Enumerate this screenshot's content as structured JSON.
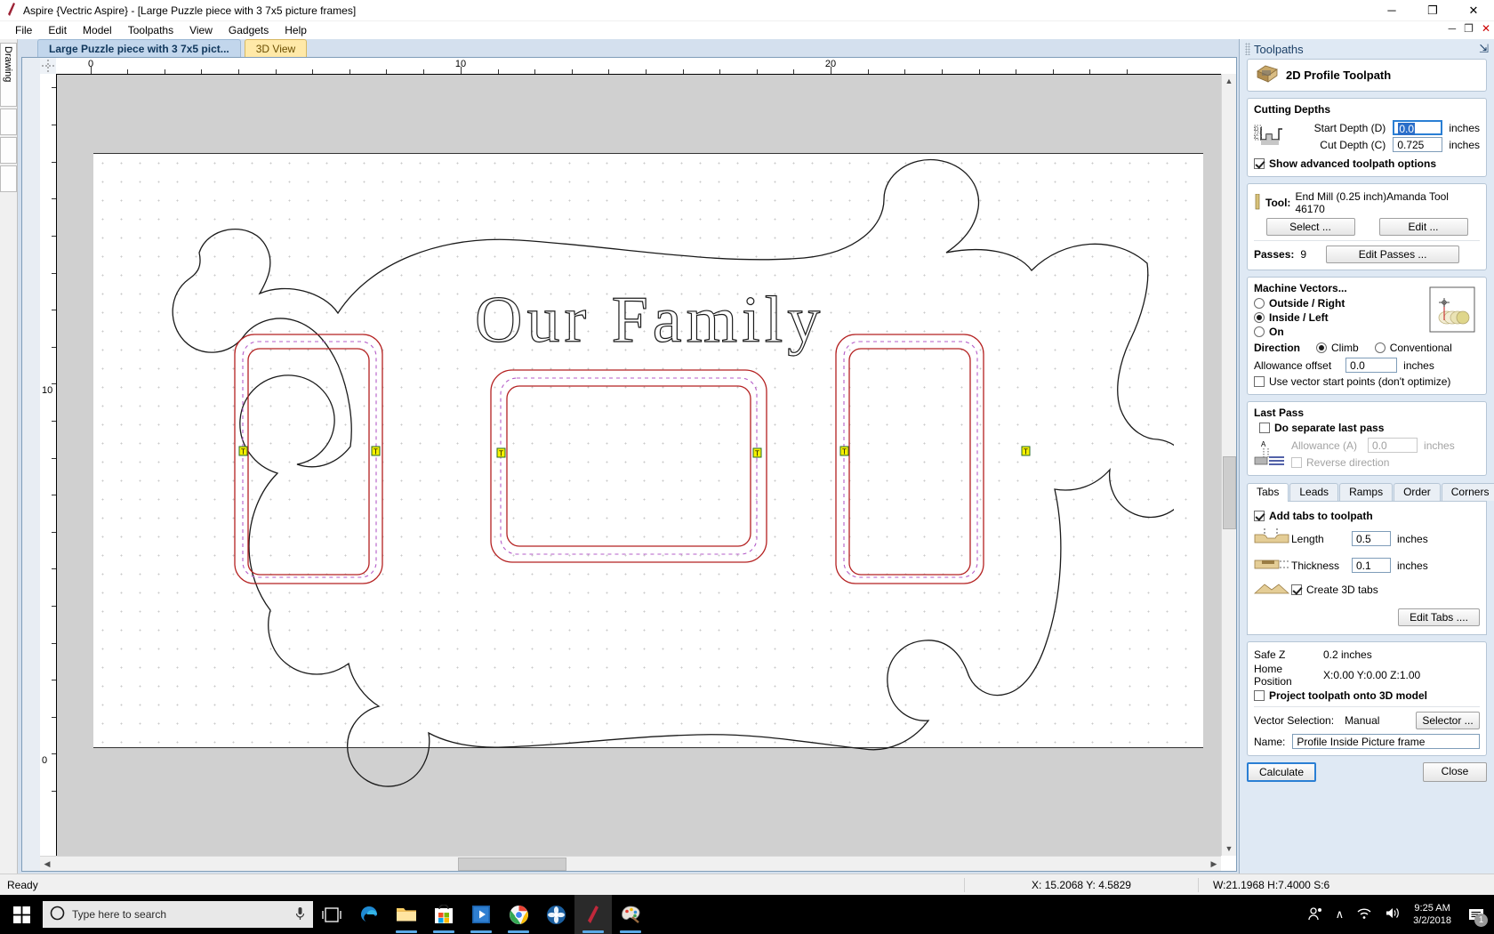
{
  "window": {
    "title": "Aspire {Vectric Aspire} - [Large Puzzle piece with 3 7x5 picture frames]",
    "minimize": "─",
    "maximize": "❐",
    "close": "✕",
    "inner_restore": "❐",
    "inner_min": "─",
    "inner_close": "✕"
  },
  "menu": [
    "File",
    "Edit",
    "Model",
    "Toolpaths",
    "View",
    "Gadgets",
    "Help"
  ],
  "left_strip": {
    "label": "Drawing"
  },
  "doc_tabs": [
    {
      "label": "Large Puzzle piece with 3 7x5 pict...",
      "active": true
    },
    {
      "label": "3D View",
      "active": false
    }
  ],
  "ruler": {
    "h_labels": [
      "0",
      "10",
      "20"
    ],
    "v_labels": [
      "10",
      "0"
    ]
  },
  "canvas": {
    "headline_text": "Our Family"
  },
  "toolpaths": {
    "panel_title": "Toolpaths",
    "pin_icon": "⇲",
    "header": "2D Profile Toolpath",
    "cutting_depths": {
      "title": "Cutting Depths",
      "start_label": "Start Depth (D)",
      "start_value": "0.0",
      "start_units": "inches",
      "cut_label": "Cut Depth (C)",
      "cut_value": "0.725",
      "cut_units": "inches",
      "advanced_label": "Show advanced toolpath options",
      "advanced_checked": true
    },
    "tool": {
      "label": "Tool:",
      "name": "End Mill (0.25 inch)Amanda Tool 46170",
      "select_btn": "Select ...",
      "edit_btn": "Edit ...",
      "passes_label": "Passes:",
      "passes_value": "9",
      "edit_passes_btn": "Edit Passes ..."
    },
    "machine_vectors": {
      "title": "Machine Vectors...",
      "options": [
        {
          "label": "Outside / Right",
          "selected": false
        },
        {
          "label": "Inside / Left",
          "selected": true
        },
        {
          "label": "On",
          "selected": false
        }
      ],
      "direction_label": "Direction",
      "directions": [
        {
          "label": "Climb",
          "selected": true
        },
        {
          "label": "Conventional",
          "selected": false
        }
      ],
      "allowance_label": "Allowance offset",
      "allowance_value": "0.0",
      "allowance_units": "inches",
      "vector_start_label": "Use vector start points (don't optimize)",
      "vector_start_checked": false
    },
    "last_pass": {
      "title": "Last Pass",
      "separate_label": "Do separate last pass",
      "separate_checked": false,
      "allowance_label": "Allowance (A)",
      "allowance_value": "0.0",
      "allowance_units": "inches",
      "reverse_label": "Reverse direction",
      "reverse_checked": false,
      "pic_letter": "A"
    },
    "tabs_widget": {
      "tabs": [
        "Tabs",
        "Leads",
        "Ramps",
        "Order",
        "Corners"
      ],
      "active": "Tabs",
      "add_tabs_label": "Add tabs to toolpath",
      "add_tabs_checked": true,
      "length_label": "Length",
      "length_value": "0.5",
      "length_units": "inches",
      "thickness_label": "Thickness",
      "thickness_value": "0.1",
      "thickness_units": "inches",
      "create3d_label": "Create 3D tabs",
      "create3d_checked": true,
      "edit_tabs_btn": "Edit Tabs ...."
    },
    "footer": {
      "safez_label": "Safe Z",
      "safez_value": "0.2 inches",
      "home_label": "Home Position",
      "home_value": "X:0.00 Y:0.00 Z:1.00",
      "project_label": "Project toolpath onto 3D model",
      "project_checked": false,
      "vector_sel_label": "Vector Selection:",
      "vector_sel_value": "Manual",
      "selector_btn": "Selector ...",
      "name_label": "Name:",
      "name_value": "Profile Inside Picture frame"
    },
    "calculate_btn": "Calculate",
    "close_btn": "Close"
  },
  "statusbar": {
    "ready": "Ready",
    "coords": "X: 15.2068 Y:  4.5829",
    "dims": "W:21.1968  H:7.4000  S:6"
  },
  "taskbar": {
    "search_placeholder": "Type here to search",
    "start_icon": "windows-logo",
    "search_icon": "circle-search",
    "mic_icon": "microphone",
    "icons": [
      "task-view-icon",
      "edge-icon",
      "file-explorer-icon",
      "microsoft-store-icon",
      "media-player-icon",
      "chrome-icon",
      "photos-icon",
      "aspire-icon",
      "paint-icon"
    ],
    "tray": {
      "people_icon": "people",
      "chevron": "∧",
      "wifi_icon": "wifi",
      "volume_icon": "volume"
    },
    "time": "9:25 AM",
    "date": "3/2/2018",
    "notification_count": "1"
  },
  "colors": {
    "accent": "#2a7fd4",
    "panel": "#dfe9f4",
    "toolpath_red": "#b42020",
    "toolpath_purple": "#b45cc8",
    "tab_marker": "#f5f000"
  }
}
